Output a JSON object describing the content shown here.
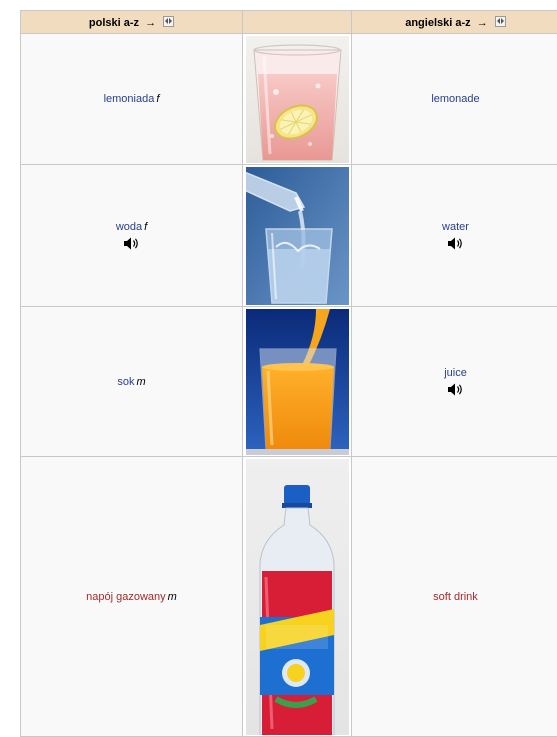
{
  "header": {
    "col1_label": "polski a-z",
    "col3_label": "angielski a-z",
    "sort_arrow": "→"
  },
  "rows": [
    {
      "pl": "lemoniada",
      "pl_gender": "f",
      "en": "lemonade",
      "pl_audio": false,
      "en_audio": false,
      "image": "lemonade-glass"
    },
    {
      "pl": "woda",
      "pl_gender": "f",
      "en": "water",
      "pl_audio": true,
      "en_audio": true,
      "image": "water-pouring"
    },
    {
      "pl": "sok",
      "pl_gender": "m",
      "en": "juice",
      "pl_audio": false,
      "en_audio": true,
      "image": "orange-juice"
    },
    {
      "pl": "napój gazowany",
      "pl_gender": "m",
      "en": "soft drink",
      "pl_audio": false,
      "en_audio": false,
      "image": "soda-bottle"
    }
  ],
  "colors": {
    "header_bg": "#f2dcc0",
    "link": "#2a3f8f",
    "new_link": "#a52a2a"
  },
  "icons": [
    "sort-icon",
    "speaker-icon"
  ]
}
